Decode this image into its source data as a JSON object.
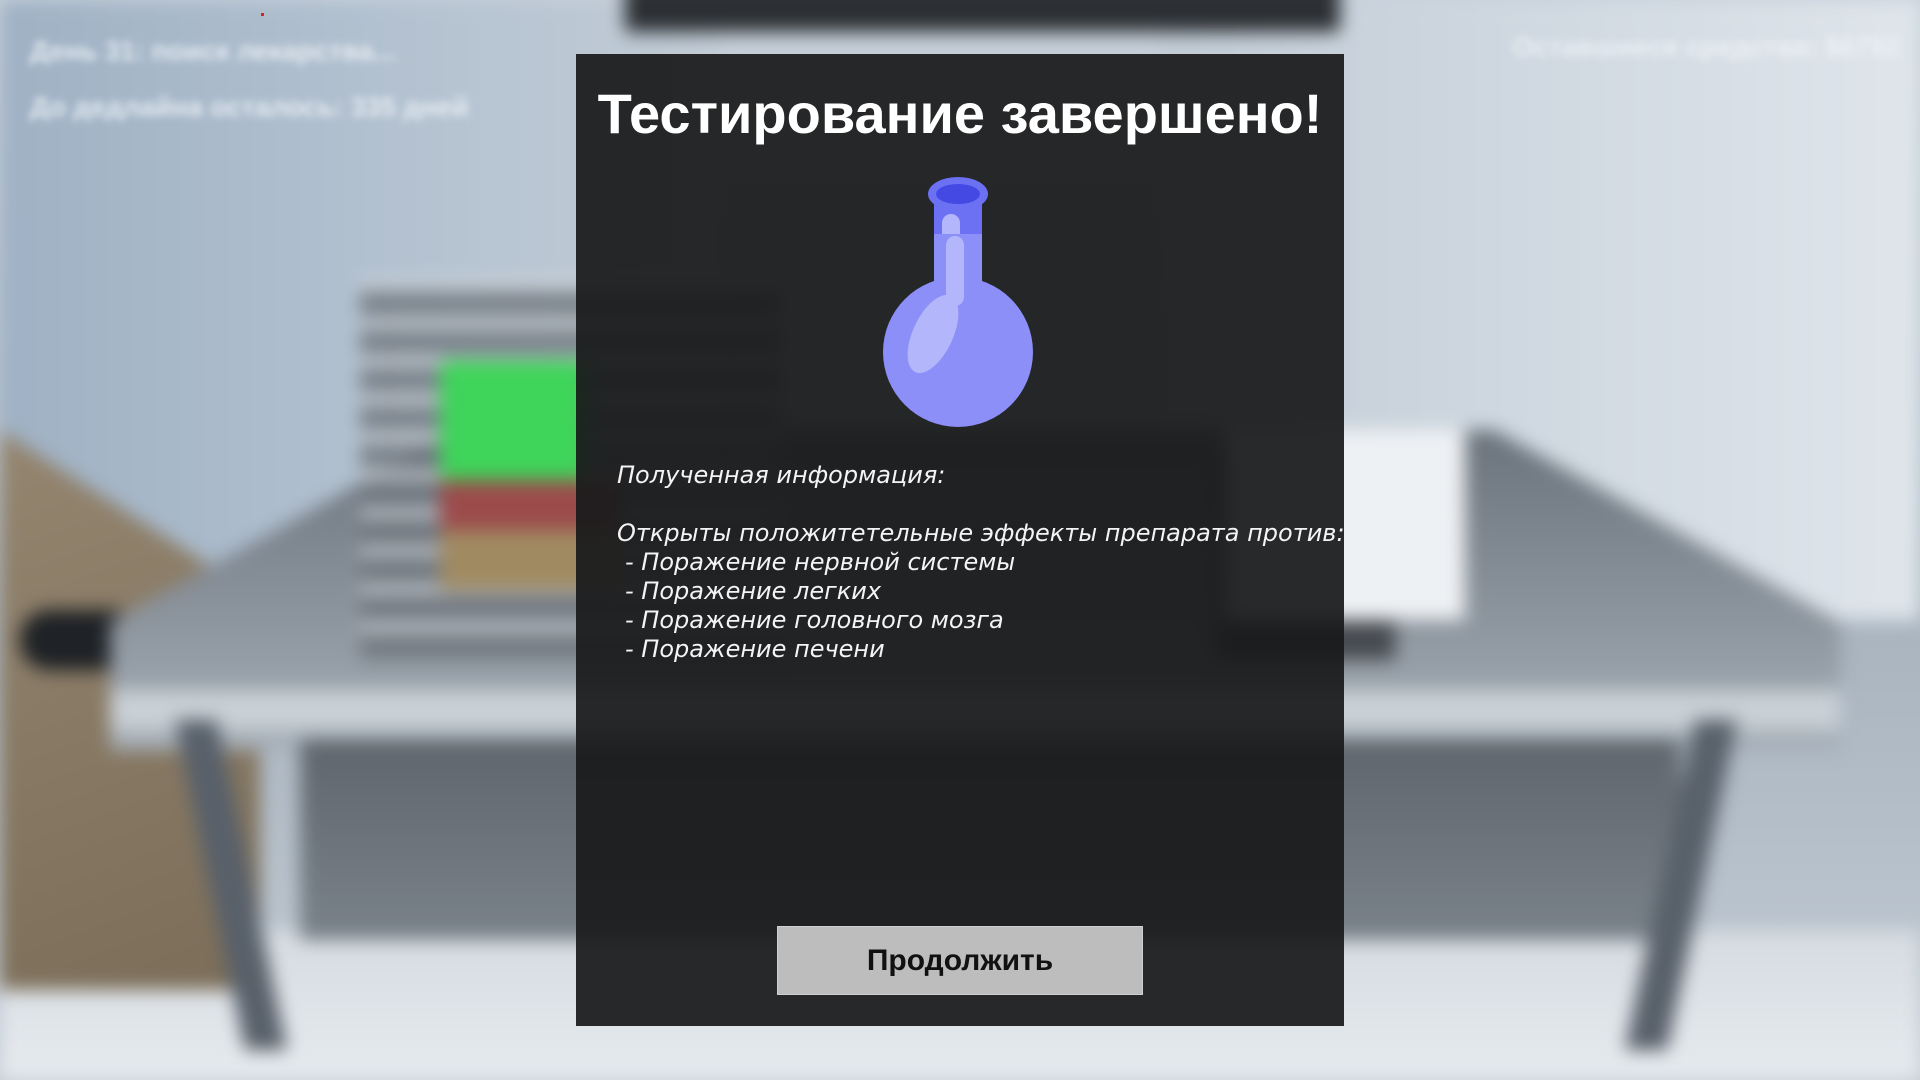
{
  "hud": {
    "day_status": "День 31: поиск лекарства...",
    "deadline": "До дедлайна осталось: 335 дней",
    "funds": "Оставшиеся средства: $6792"
  },
  "dialog": {
    "title": "Тестирование завершено!",
    "icon": "flask-icon",
    "info_heading": "Полученная информация:",
    "effects_intro": "Открыты положитетельные эффекты препарата против:",
    "effects": [
      "- Поражение нервной системы",
      "- Поражение легких",
      "- Поражение головного мозга",
      "- Поражение печени"
    ],
    "continue_label": "Продолжить"
  },
  "colors": {
    "dialog_bg": "#1a1b1c",
    "flask_fill": "#8c8ff7",
    "flask_dark": "#5e62ea",
    "button_bg": "#bdbdbd"
  }
}
